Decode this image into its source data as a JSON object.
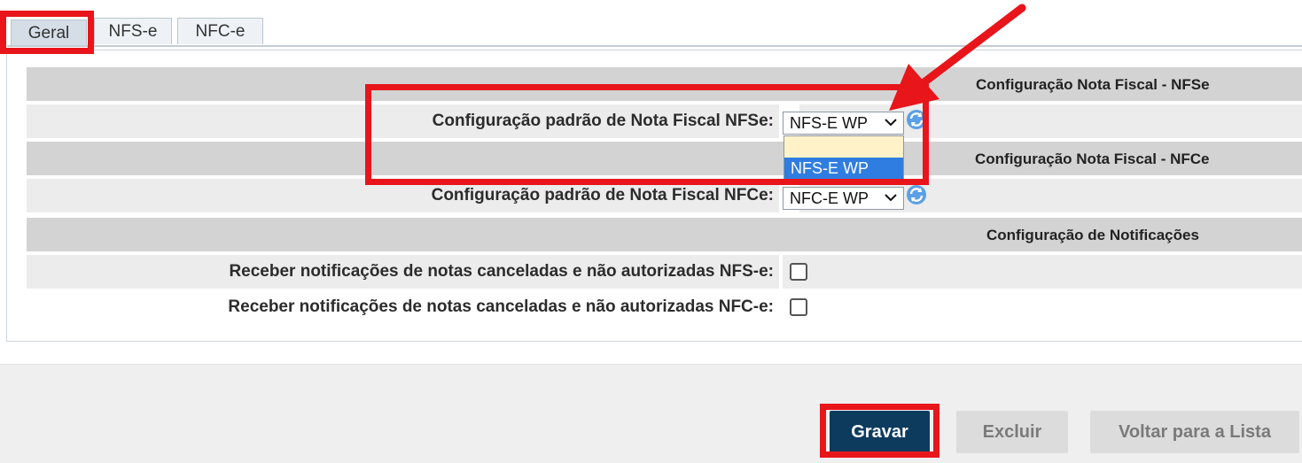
{
  "tabs": [
    {
      "label": "Geral",
      "active": true
    },
    {
      "label": "NFS-e",
      "active": false
    },
    {
      "label": "NFC-e",
      "active": false
    }
  ],
  "sections": {
    "nfse_header": "Configuração Nota Fiscal - NFSe",
    "nfce_header": "Configuração Nota Fiscal - NFCe",
    "notif_header": "Configuração de Notificações"
  },
  "fields": {
    "nfse_label": "Configuração padrão de Nota Fiscal NFSe:",
    "nfse_value": "NFS-E WP",
    "nfse_options": [
      "",
      "NFS-E WP"
    ],
    "nfce_label": "Configuração padrão de Nota Fiscal NFCe:",
    "nfce_value": "NFC-E WP",
    "notif_nfse_label": "Receber notificações de notas canceladas e não autorizadas NFS-e:",
    "notif_nfse_checked": false,
    "notif_nfce_label": "Receber notificações de notas canceladas e não autorizadas NFC-e:",
    "notif_nfce_checked": false
  },
  "buttons": {
    "save": "Gravar",
    "delete": "Excluir",
    "back": "Voltar para a Lista"
  },
  "colors": {
    "highlight": "#e8151b",
    "primary_button": "#0d3b5e",
    "selected_option": "#2f7de1",
    "section_bg": "#d3d3d3"
  }
}
